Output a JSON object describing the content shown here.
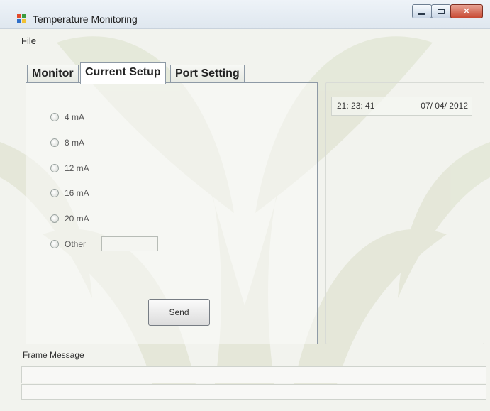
{
  "window": {
    "title": "Temperature Monitoring",
    "close_symbol": "✕",
    "minimize_icon": "minimize-icon",
    "maximize_icon": "maximize-icon"
  },
  "menu": {
    "file_label": "File"
  },
  "tabs": [
    {
      "label": "Monitor",
      "active": false
    },
    {
      "label": "Current Setup",
      "active": true
    },
    {
      "label": "Port Setting",
      "active": false
    }
  ],
  "current_setup": {
    "options": [
      {
        "label": "4 mA"
      },
      {
        "label": "8 mA"
      },
      {
        "label": "12 mA"
      },
      {
        "label": "16 mA"
      },
      {
        "label": "20 mA"
      },
      {
        "label": "Other"
      }
    ],
    "other_value": "",
    "send_label": "Send"
  },
  "clock": {
    "time": "21: 23: 41",
    "date": "07/ 04/ 2012"
  },
  "frame": {
    "label": "Frame Message",
    "line1": "",
    "line2": ""
  },
  "colors": {
    "watermark": "#e6e9d8",
    "close_button": "#c74a33"
  }
}
